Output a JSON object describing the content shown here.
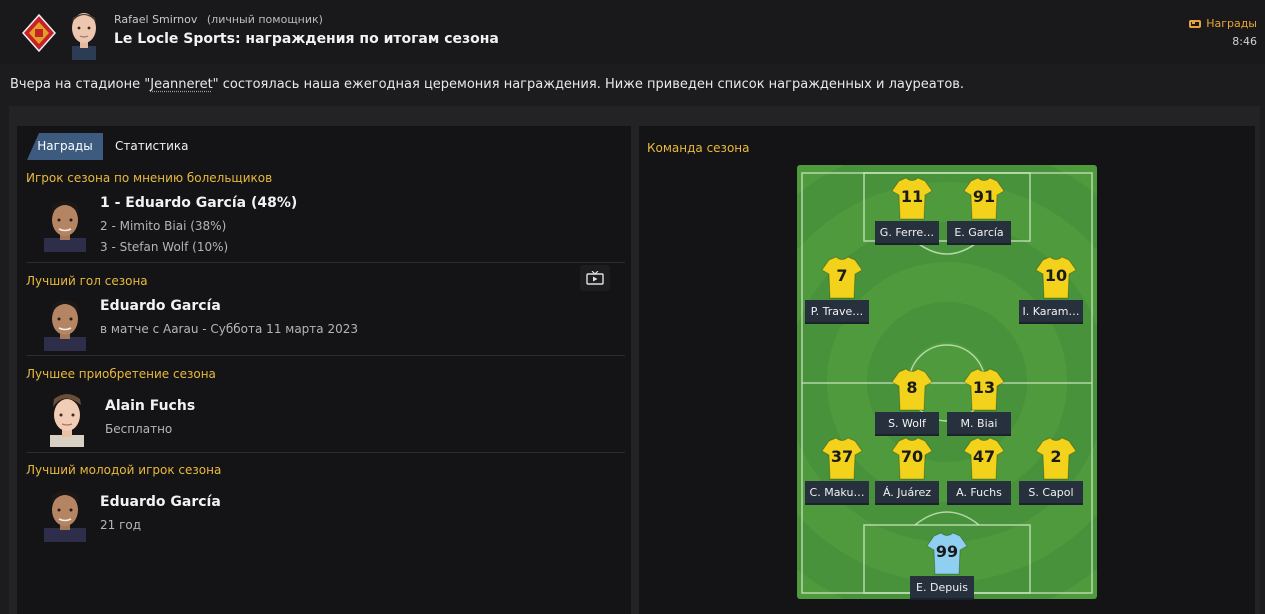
{
  "header": {
    "sender_name": "Rafael Smirnov",
    "sender_role": "(личный помощник)",
    "subject": "Le Locle Sports: награждения по итогам сезона",
    "tag_label": "Награды",
    "time": "8:46",
    "icons": {
      "club": "club-badge-icon",
      "tag": "tag-icon"
    }
  },
  "intro": {
    "before": "Вчера на стадионе \"",
    "link": "Jeanneret",
    "after": "\" состоялась наша ежегодная церемония награждения. Ниже приведен список награжденных и лауреатов."
  },
  "tabs": [
    {
      "label": "Награды",
      "active": true
    },
    {
      "label": "Статистика",
      "active": false
    }
  ],
  "awards": {
    "fans_player": {
      "title": "Игрок сезона по мнению болельщиков",
      "winner": "1 - Eduardo García (48%)",
      "second": "2 - Mimito Biai (38%)",
      "third": "3 - Stefan Wolf (10%)"
    },
    "best_goal": {
      "title": "Лучший гол сезона",
      "name": "Eduardo García",
      "detail": "в матче с Aarau - Суббота 11 марта 2023",
      "icon": "tv-play-icon"
    },
    "best_signing": {
      "title": "Лучшее приобретение сезона",
      "name": "Alain Fuchs",
      "detail": "Бесплатно"
    },
    "best_young": {
      "title": "Лучший молодой игрок сезона",
      "name": "Eduardo García",
      "detail": "21 год"
    }
  },
  "team_of_season": {
    "title": "Команда сезона",
    "colors": {
      "outfield_shirt": "#f2d21a",
      "keeper_shirt": "#8fd0f0",
      "pitch": "#4f9a3c"
    },
    "players": [
      {
        "number": "11",
        "name": "G. Ferre…"
      },
      {
        "number": "91",
        "name": "E. García"
      },
      {
        "number": "7",
        "name": "P. Trave…"
      },
      {
        "number": "10",
        "name": "I. Karam…"
      },
      {
        "number": "8",
        "name": "S. Wolf"
      },
      {
        "number": "13",
        "name": "M. Biai"
      },
      {
        "number": "37",
        "name": "C. Maku…"
      },
      {
        "number": "70",
        "name": "Á. Juárez"
      },
      {
        "number": "47",
        "name": "A. Fuchs"
      },
      {
        "number": "2",
        "name": "S. Capol"
      },
      {
        "number": "99",
        "name": "E. Depuis"
      }
    ]
  }
}
